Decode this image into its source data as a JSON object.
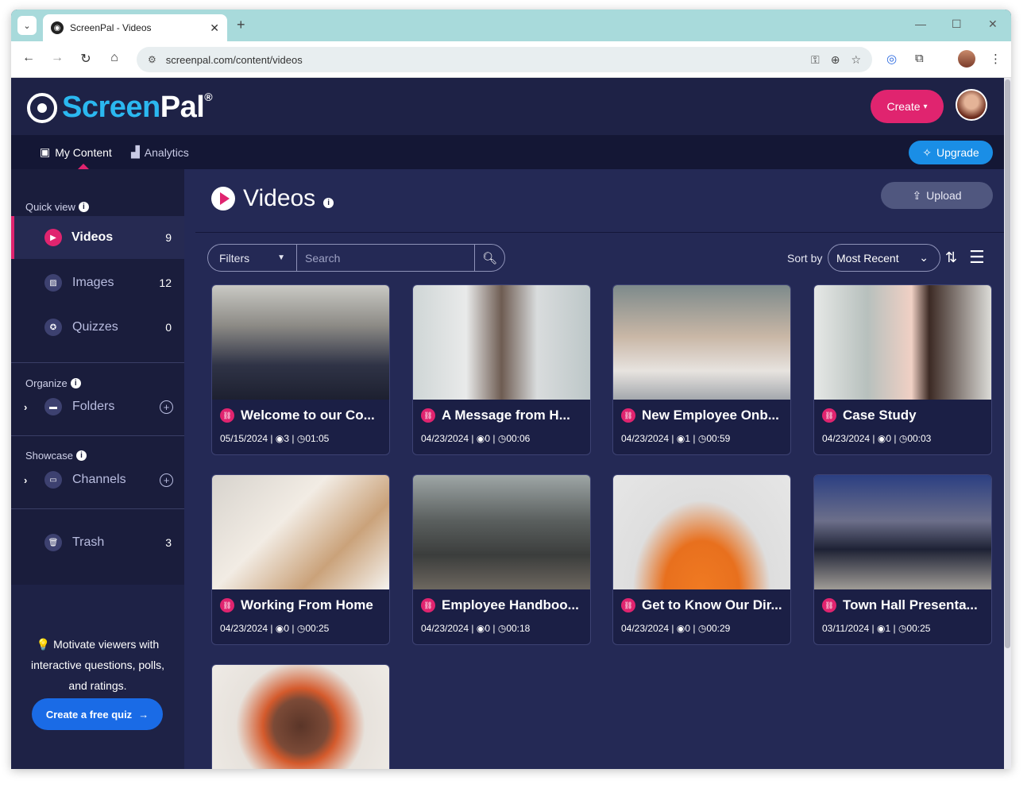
{
  "browser": {
    "tab_title": "ScreenPal - Videos",
    "url": "screenpal.com/content/videos",
    "new_tab": "+",
    "close": "✕"
  },
  "header": {
    "logo_part1": "Screen",
    "logo_part2": "Pal",
    "logo_mark": "®",
    "create_label": "Create"
  },
  "nav": {
    "my_content": "My Content",
    "analytics": "Analytics",
    "upgrade": "Upgrade"
  },
  "sidebar": {
    "quick_view": "Quick view",
    "organize": "Organize",
    "showcase": "Showcase",
    "videos": {
      "label": "Videos",
      "count": "9"
    },
    "images": {
      "label": "Images",
      "count": "12"
    },
    "quizzes": {
      "label": "Quizzes",
      "count": "0"
    },
    "folders": {
      "label": "Folders"
    },
    "channels": {
      "label": "Channels"
    },
    "trash": {
      "label": "Trash",
      "count": "3"
    },
    "promo_text": "Motivate viewers with interactive questions, polls, and ratings.",
    "promo_button": "Create a free quiz"
  },
  "main": {
    "title": "Videos",
    "upload": "Upload",
    "filters": "Filters",
    "search_placeholder": "Search",
    "sort_by": "Sort by",
    "sort_value": "Most Recent"
  },
  "videos": [
    {
      "title": "Welcome to our Co...",
      "date": "05/15/2024",
      "views": "3",
      "duration": "01:05"
    },
    {
      "title": "A Message from H...",
      "date": "04/23/2024",
      "views": "0",
      "duration": "00:06"
    },
    {
      "title": "New Employee Onb...",
      "date": "04/23/2024",
      "views": "1",
      "duration": "00:59"
    },
    {
      "title": "Case Study",
      "date": "04/23/2024",
      "views": "0",
      "duration": "00:03"
    },
    {
      "title": "Working From Home",
      "date": "04/23/2024",
      "views": "0",
      "duration": "00:25"
    },
    {
      "title": "Employee Handboo...",
      "date": "04/23/2024",
      "views": "0",
      "duration": "00:18"
    },
    {
      "title": "Get to Know Our Dir...",
      "date": "04/23/2024",
      "views": "0",
      "duration": "00:29"
    },
    {
      "title": "Town Hall Presenta...",
      "date": "03/11/2024",
      "views": "1",
      "duration": "00:25"
    }
  ],
  "colors": {
    "accent": "#e0246f",
    "brand_blue": "#2bb8f0",
    "bg": "#242955"
  }
}
